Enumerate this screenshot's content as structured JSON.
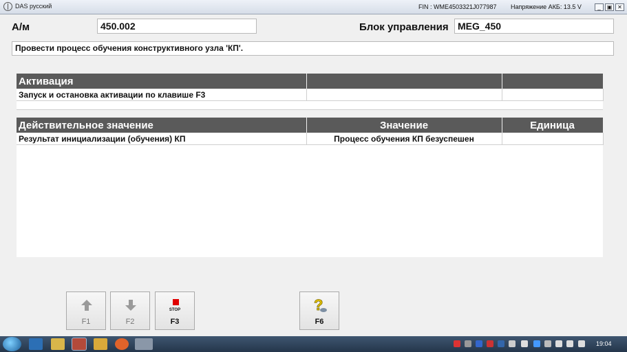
{
  "window": {
    "title": "DAS русский",
    "fin": "FIN : WME4503321J077987",
    "battery": "Напряжение АКБ: 13.5 V",
    "buttons": {
      "minimize": "_",
      "restore": "▣",
      "close": "✕"
    }
  },
  "header": {
    "am_label": "А/м",
    "am_value": "450.002",
    "control_unit_label": "Блок управления",
    "control_unit_value": "MEG_450"
  },
  "instruction": "Провести процесс обучения конструктивного узла 'КП'.",
  "activation_table": {
    "headers": [
      "Активация",
      "",
      ""
    ],
    "rows": [
      [
        "Запуск и остановка активации по клавише F3",
        "",
        ""
      ]
    ]
  },
  "values_table": {
    "headers": [
      "Действительное значение",
      "Значение",
      "Единица"
    ],
    "rows": [
      [
        "Результат инициализации (обучения) КП",
        "Процесс обучения КП безуспешен",
        ""
      ]
    ]
  },
  "function_keys": {
    "f1": {
      "label": "F1",
      "icon": "arrow-up-icon"
    },
    "f2": {
      "label": "F2",
      "icon": "arrow-down-icon"
    },
    "f3": {
      "label": "F3",
      "icon": "stop-icon",
      "icon_text": "STOP"
    },
    "f6": {
      "label": "F6",
      "icon": "help-icon"
    }
  },
  "taskbar": {
    "clock": "19:04"
  },
  "colors": {
    "table_header": "#5a5a5a",
    "stop_red": "#e00000",
    "help_yellow": "#e8c400"
  }
}
